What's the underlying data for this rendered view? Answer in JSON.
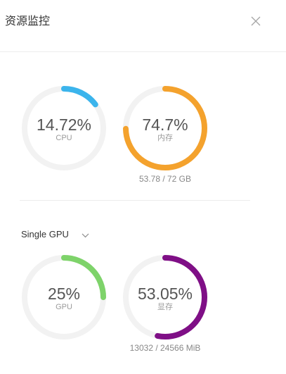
{
  "header": {
    "title": "资源监控"
  },
  "system": {
    "cpu": {
      "value_text": "14.72%",
      "label": "CPU",
      "fraction": 0.1472,
      "color": "#3bb4ec"
    },
    "memory": {
      "value_text": "74.7%",
      "label": "内存",
      "fraction": 0.747,
      "color": "#f4a22d",
      "detail": "53.78 / 72 GB"
    }
  },
  "gpu_section": {
    "selector_label": "Single GPU",
    "gpu": {
      "value_text": "25%",
      "label": "GPU",
      "fraction": 0.25,
      "color": "#7ed36a"
    },
    "vram": {
      "value_text": "53.05%",
      "label": "显存",
      "fraction": 0.5305,
      "color": "#7f0f86",
      "detail": "13032 / 24566 MiB"
    }
  },
  "colors": {
    "track": "#f2f2f2",
    "divider": "#ececec"
  }
}
